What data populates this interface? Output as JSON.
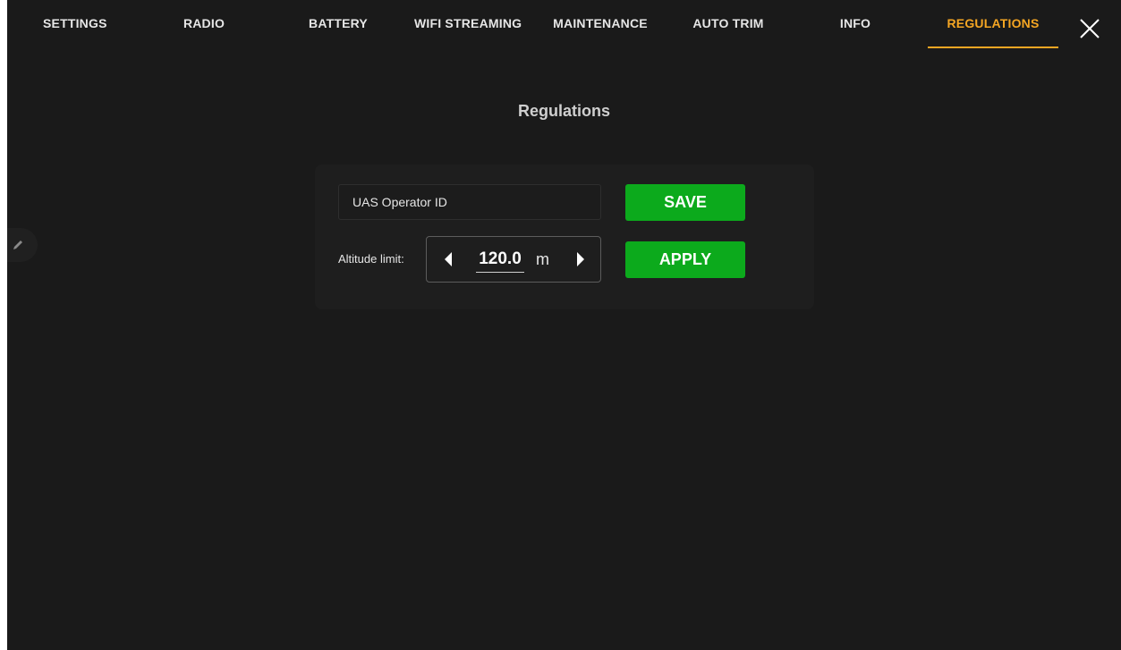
{
  "tabs": [
    {
      "label": "SETTINGS"
    },
    {
      "label": "RADIO"
    },
    {
      "label": "BATTERY"
    },
    {
      "label": "WIFI STREAMING"
    },
    {
      "label": "MAINTENANCE"
    },
    {
      "label": "AUTO TRIM"
    },
    {
      "label": "INFO"
    },
    {
      "label": "REGULATIONS",
      "active": true
    }
  ],
  "close_icon": "close-x-icon",
  "edit_icon": "pencil-icon",
  "page": {
    "title": "Regulations"
  },
  "operator_id": {
    "value": "",
    "placeholder": "UAS Operator ID"
  },
  "buttons": {
    "save_label": "SAVE",
    "apply_label": "APPLY"
  },
  "altitude": {
    "label": "Altitude limit:",
    "value": "120.0",
    "unit": "m",
    "decrease_icon": "triangle-left-icon",
    "increase_icon": "triangle-right-icon"
  },
  "colors": {
    "background": "#1a1a1a",
    "active_tab": "#f5a623",
    "button_green": "#0caa1c"
  }
}
